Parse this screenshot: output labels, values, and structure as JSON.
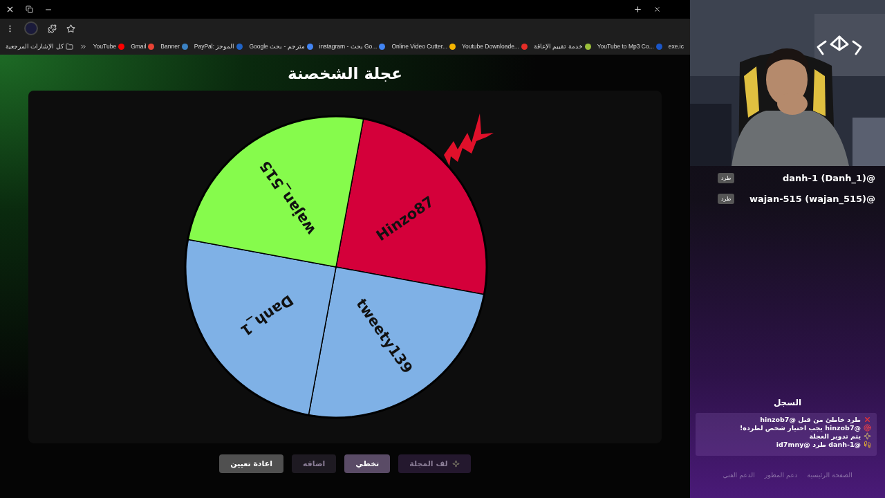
{
  "browser": {
    "bookmarks": [
      {
        "label": "exe.ic",
        "kind": "site"
      },
      {
        "label": "YouTube to Mp3 Co...",
        "kind": "site",
        "color": "#1a56c8"
      },
      {
        "label": "خدمة تقييم الإعاقة",
        "kind": "site",
        "color": "#9bbf3a"
      },
      {
        "label": "Youtube Downloade...",
        "kind": "site",
        "color": "#e52d27"
      },
      {
        "label": "Online Video Cutter...",
        "kind": "site",
        "color": "#f4b400"
      },
      {
        "label": "instagram - بحث Go...",
        "kind": "site",
        "color": "#4285f4"
      },
      {
        "label": "Google مترجم - بحث",
        "kind": "site",
        "color": "#4285f4"
      },
      {
        "label": "PayPal: الموجز",
        "kind": "site",
        "color": "#1f63c6"
      },
      {
        "label": "Banner",
        "kind": "site",
        "color": "#3b82c4"
      },
      {
        "label": "Gmail",
        "kind": "site",
        "color": "#ea4335"
      },
      {
        "label": "YouTube",
        "kind": "site",
        "color": "#ff0000"
      },
      {
        "label": "كل الإشارات المرجعية",
        "kind": "folder"
      }
    ]
  },
  "page": {
    "title": "عجلة الشخصنة",
    "wheel": {
      "segments": [
        {
          "label": "Hinzo87",
          "color": "#d4003a"
        },
        {
          "label": "tweety139",
          "color": "#7fb1e6"
        },
        {
          "label": "Danh_1",
          "color": "#7fb1e6"
        },
        {
          "label": "wajan_515",
          "color": "#86fb4c"
        }
      ]
    },
    "buttons": [
      {
        "label": "لف المجلة",
        "kind": "spin",
        "disabled": true
      },
      {
        "label": "تخطي",
        "kind": "skip",
        "disabled": false
      },
      {
        "label": "اضافه",
        "kind": "add",
        "disabled": true
      },
      {
        "label": "اعادة تعيين",
        "kind": "reset",
        "disabled": false
      }
    ]
  },
  "overlay": {
    "players": [
      {
        "name": "@danh-1 (Danh_1)",
        "kick": "طرد"
      },
      {
        "name": "@wajan-515 (wajan_515)",
        "kick": "طرد"
      }
    ],
    "log_title": "السجل",
    "log": [
      {
        "kind": "wrong",
        "text": "طرد خاطئ من قبل @hinzob7"
      },
      {
        "kind": "target",
        "text": "@hinzob7 يجب اختيار شخص لطرده!"
      },
      {
        "kind": "spin",
        "text": "يتم تدوير العجلة"
      },
      {
        "kind": "kick",
        "text": "@danh-1 طرد @id7mny"
      }
    ],
    "footer_links": [
      "الصفحة الرئيسية",
      "دعم المطور",
      "الدعم الفني"
    ]
  }
}
